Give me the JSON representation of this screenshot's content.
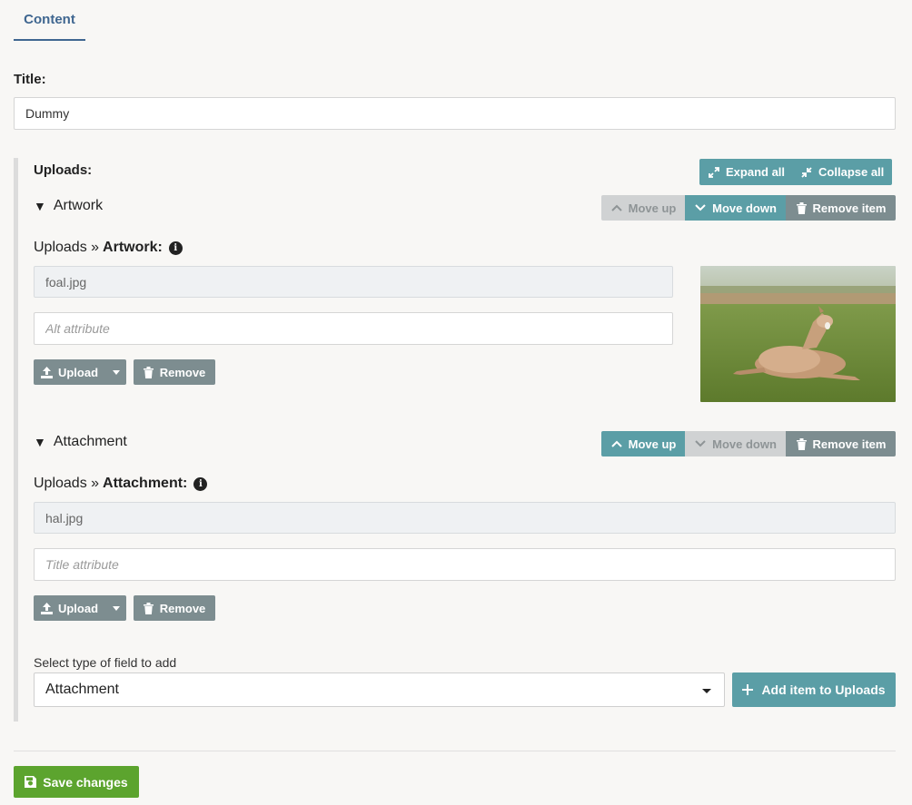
{
  "tabs": [
    {
      "label": "Content"
    }
  ],
  "title_field": {
    "label": "Title:",
    "value": "Dummy"
  },
  "uploads": {
    "label": "Uploads:",
    "expand_all": "Expand all",
    "collapse_all": "Collapse all",
    "items": [
      {
        "name": "Artwork",
        "move_up": "Move up",
        "move_down": "Move down",
        "remove_item": "Remove item",
        "crumb_prefix": "Uploads »",
        "crumb_field": "Artwork:",
        "file_value": "foal.jpg",
        "attr_placeholder": "Alt attribute",
        "upload_label": "Upload",
        "remove_label": "Remove",
        "thumbnail": "foal-photo"
      },
      {
        "name": "Attachment",
        "move_up": "Move up",
        "move_down": "Move down",
        "remove_item": "Remove item",
        "crumb_prefix": "Uploads »",
        "crumb_field": "Attachment:",
        "file_value": "hal.jpg",
        "attr_placeholder": "Title attribute",
        "upload_label": "Upload",
        "remove_label": "Remove"
      }
    ],
    "add_field": {
      "label": "Select type of field to add",
      "selected": "Attachment",
      "button": "Add item to Uploads"
    }
  },
  "save": {
    "label": "Save changes"
  },
  "colors": {
    "accent": "#3f6690",
    "teal": "#5b9ea6",
    "gray_button": "#7d8d90",
    "save_green": "#5ca42e"
  }
}
